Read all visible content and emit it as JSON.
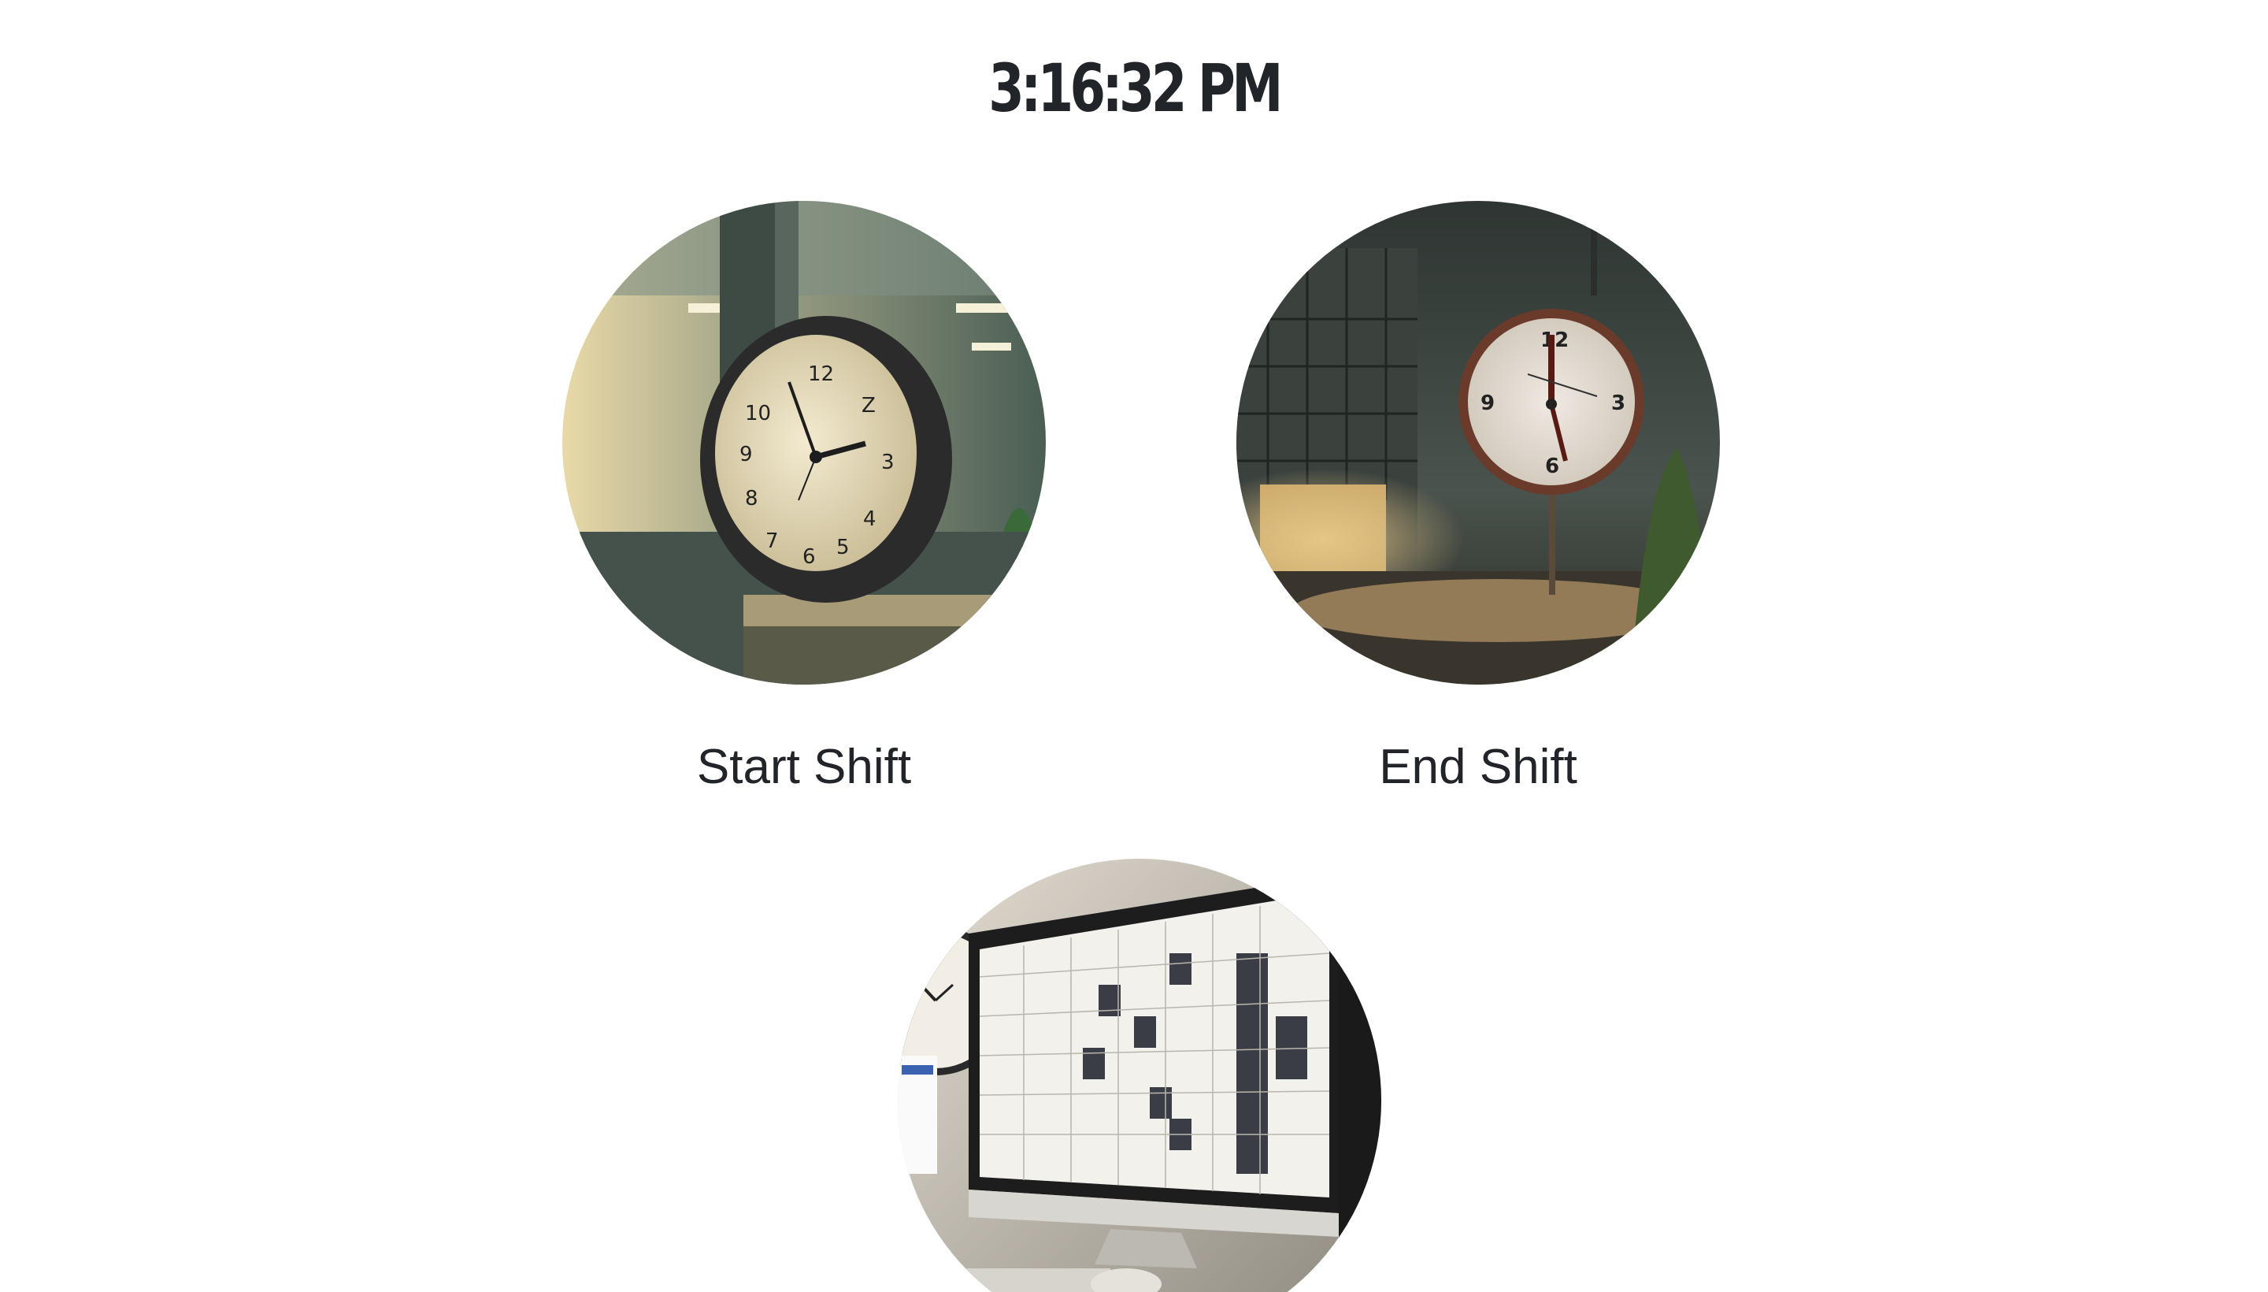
{
  "clock": {
    "time": "3:16:32 PM"
  },
  "actions": [
    {
      "id": "start",
      "label": "Start Shift",
      "image": "office-clock-illustration"
    },
    {
      "id": "end",
      "label": "End Shift",
      "image": "street-clock-illustration"
    },
    {
      "id": "schedule",
      "label": "",
      "image": "schedule-monitor-illustration"
    }
  ],
  "colors": {
    "text": "#212529",
    "background": "#ffffff"
  }
}
